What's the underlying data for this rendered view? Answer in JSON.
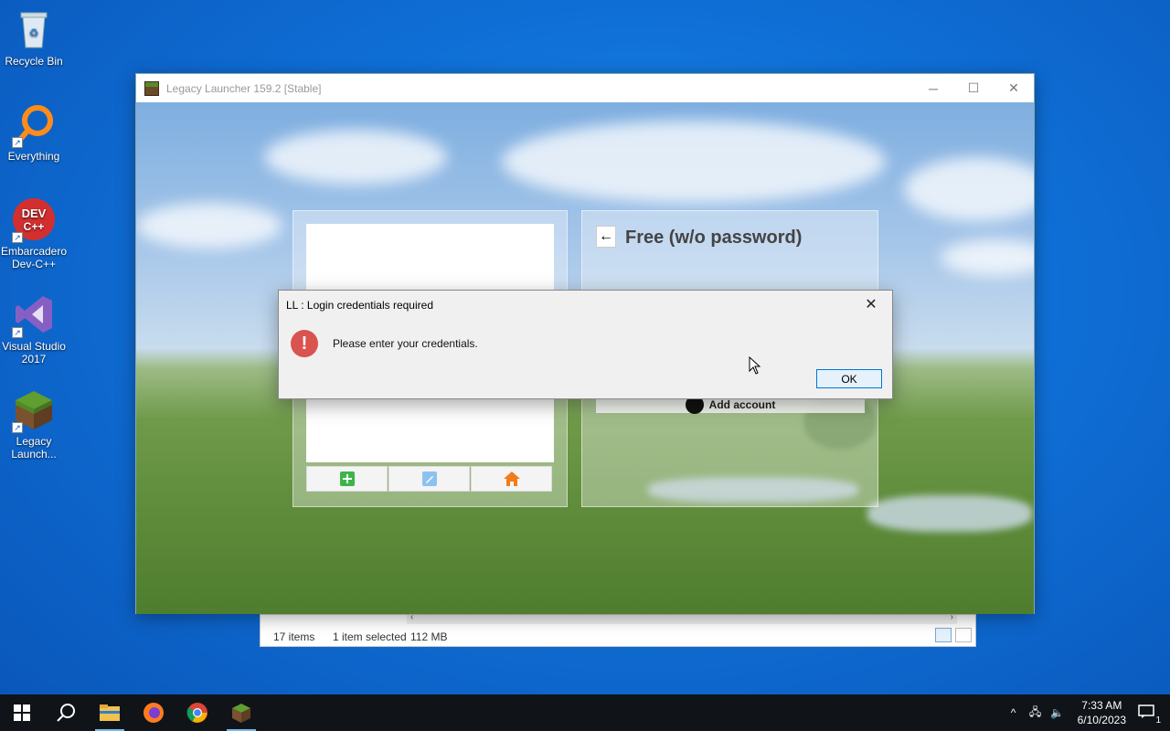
{
  "desktop": {
    "icons": [
      {
        "label": "Recycle Bin"
      },
      {
        "label": "Everything"
      },
      {
        "label": "Embarcadero Dev-C++"
      },
      {
        "label": "Visual Studio 2017"
      },
      {
        "label": "Legacy Launch..."
      }
    ]
  },
  "explorer": {
    "items_count": "17 items",
    "selection": "1 item selected",
    "size": "112 MB"
  },
  "launcher": {
    "title": "Legacy Launcher 159.2 [Stable]",
    "right_panel_title": "Free (w/o password)",
    "add_account_label": "Add account",
    "buttons": {
      "add": "add-icon",
      "edit": "edit-icon",
      "home": "home-icon"
    }
  },
  "dialog": {
    "title": "LL : Login credentials required",
    "message": "Please enter your credentials.",
    "ok_label": "OK"
  },
  "taskbar": {
    "time": "7:33 AM",
    "date": "6/10/2023",
    "notification_count": "1"
  }
}
